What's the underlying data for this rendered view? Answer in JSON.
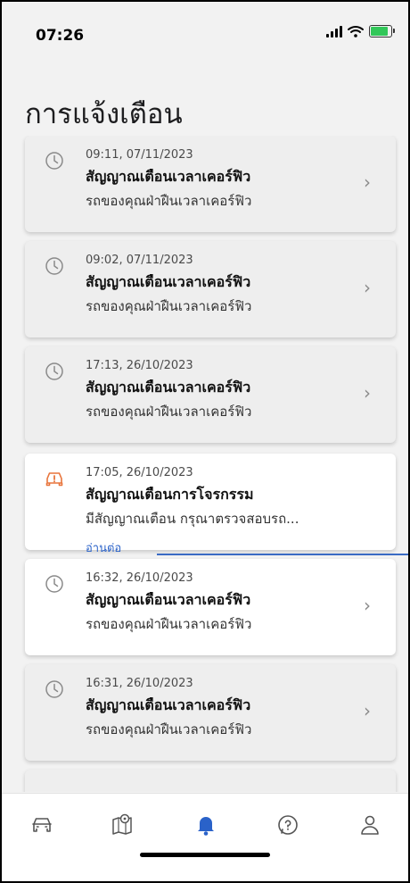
{
  "status_bar": {
    "time": "07:26"
  },
  "header": {
    "title": "การแจ้งเตือน"
  },
  "notifications": [
    {
      "timestamp": "09:11, 07/11/2023",
      "title": "สัญญาณเตือนเวลาเคอร์ฟิว",
      "message": "รถของคุณฝ่าฝืนเวลาเคอร์ฟิว",
      "icon": "clock-icon",
      "read": true
    },
    {
      "timestamp": "09:02, 07/11/2023",
      "title": "สัญญาณเตือนเวลาเคอร์ฟิว",
      "message": "รถของคุณฝ่าฝืนเวลาเคอร์ฟิว",
      "icon": "clock-icon",
      "read": true
    },
    {
      "timestamp": "17:13, 26/10/2023",
      "title": "สัญญาณเตือนเวลาเคอร์ฟิว",
      "message": "รถของคุณฝ่าฝืนเวลาเคอร์ฟิว",
      "icon": "clock-icon",
      "read": true
    },
    {
      "timestamp": "17:05, 26/10/2023",
      "title": "สัญญาณเตือนการโจรกรรม",
      "message": "มีสัญญาณเตือน กรุณาตรวจสอบรถ...",
      "read_more": "อ่านต่อ",
      "icon": "car-alert-icon",
      "read": false
    },
    {
      "timestamp": "16:32, 26/10/2023",
      "title": "สัญญาณเตือนเวลาเคอร์ฟิว",
      "message": "รถของคุณฝ่าฝืนเวลาเคอร์ฟิว",
      "icon": "clock-icon",
      "read": false
    },
    {
      "timestamp": "16:31, 26/10/2023",
      "title": "สัญญาณเตือนเวลาเคอร์ฟิว",
      "message": "รถของคุณฝ่าฝืนเวลาเคอร์ฟิว",
      "icon": "clock-icon",
      "read": true
    }
  ],
  "colors": {
    "accent": "#2a62c9",
    "alert": "#e8743b",
    "active_tab": "#2a62c9"
  },
  "tabbar": [
    {
      "icon": "car-icon",
      "active": false
    },
    {
      "icon": "map-pin-icon",
      "active": false
    },
    {
      "icon": "bell-icon",
      "active": true
    },
    {
      "icon": "help-icon",
      "active": false
    },
    {
      "icon": "profile-icon",
      "active": false
    }
  ]
}
